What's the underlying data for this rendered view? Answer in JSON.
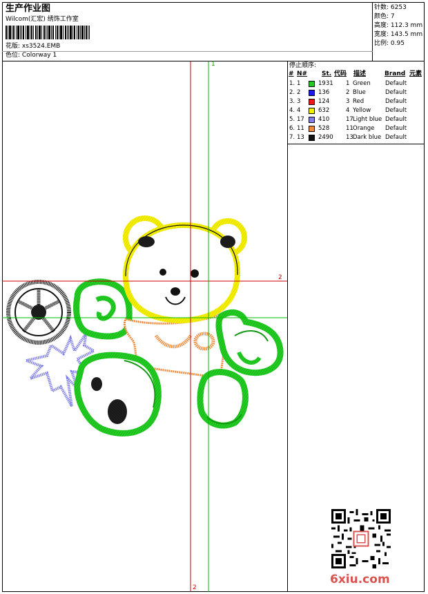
{
  "header": {
    "title": "生产作业图",
    "company": "Wilcom(汇宏) 绣饰工作室",
    "file_label": "花版:",
    "file_name": "xs3524.EMB",
    "colorway_label": "色位:",
    "colorway_name": "Colorway 1"
  },
  "stats": [
    {
      "label": "针数:",
      "value": "6253"
    },
    {
      "label": "颜色:",
      "value": "7"
    },
    {
      "label": "高度:",
      "value": "112.3 mm"
    },
    {
      "label": "宽度:",
      "value": "143.5 mm"
    },
    {
      "label": "比例:",
      "value": "0.95"
    }
  ],
  "stop_sequence": {
    "title": "停止顺序:",
    "headers": {
      "index": "#",
      "needle": "N#",
      "stitches": "St.",
      "code": "代码",
      "desc": "描述",
      "brand": "Brand",
      "element": "元素"
    },
    "rows": [
      {
        "index": "1.",
        "needle": "1",
        "color": "#22cc22",
        "stitches": "1931",
        "code": "1",
        "desc": "Green",
        "brand": "Default"
      },
      {
        "index": "2.",
        "needle": "2",
        "color": "#1a1aee",
        "stitches": "136",
        "code": "2",
        "desc": "Blue",
        "brand": "Default"
      },
      {
        "index": "3.",
        "needle": "3",
        "color": "#ee1a1a",
        "stitches": "124",
        "code": "3",
        "desc": "Red",
        "brand": "Default"
      },
      {
        "index": "4.",
        "needle": "4",
        "color": "#f5f000",
        "stitches": "632",
        "code": "4",
        "desc": "Yellow",
        "brand": "Default"
      },
      {
        "index": "5.",
        "needle": "17",
        "color": "#8080e8",
        "stitches": "410",
        "code": "17",
        "desc": "Light blue",
        "brand": "Default"
      },
      {
        "index": "6.",
        "needle": "11",
        "color": "#f08838",
        "stitches": "528",
        "code": "11",
        "desc": "Orange",
        "brand": "Default"
      },
      {
        "index": "7.",
        "needle": "13",
        "color": "#111111",
        "stitches": "2490",
        "code": "13",
        "desc": "Dark blue",
        "brand": "Default"
      }
    ]
  },
  "guides": {
    "green_label": "1",
    "red_right_label": "2",
    "red_bottom_label": "2"
  },
  "watermark": "6xiu.com",
  "colors": {
    "guide_red": "#cc0000",
    "guide_green": "#00bb00",
    "watermark": "#d9534f"
  }
}
